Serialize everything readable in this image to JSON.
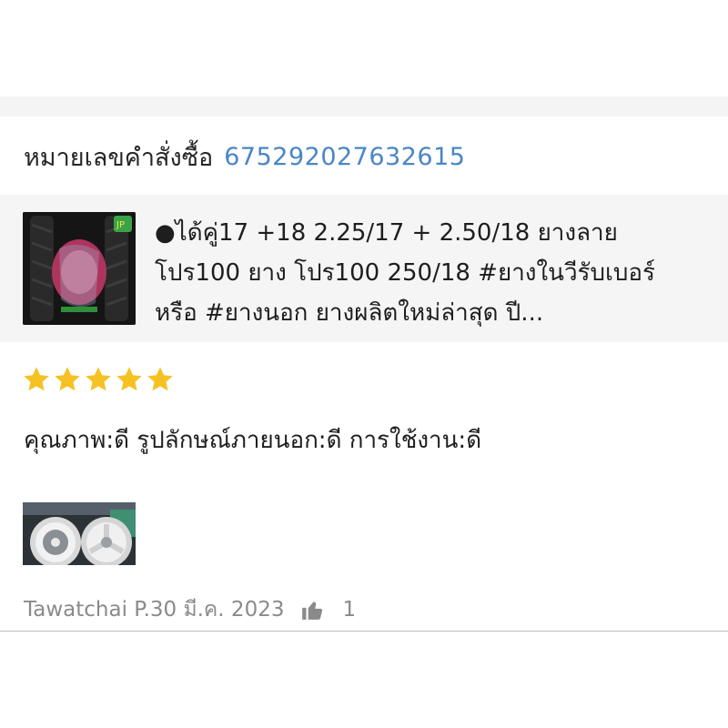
{
  "order": {
    "label": "หมายเลขคำสั่งซื้อ",
    "number": "675292027632615"
  },
  "product": {
    "title": "●ได้คู่17 +18  2.25/17 + 2.50/18   ยางลาย โปร100   ยาง โปร100   250/18 #ยางในวีรับเบอร์ หรือ #ยางนอก ยางผลิตใหม่ล่าสุด ปี...",
    "thumbnail_icon": "tire-product-image"
  },
  "review": {
    "rating": 5,
    "rating_max": 5,
    "star_color": "#f6c223",
    "text": "คุณภาพ:ดี รูปลักษณ์ภายนอก:ดี การใช้งาน:ดี",
    "photo_icon": "motorcycle-wheels-photo"
  },
  "footer": {
    "meta": "Tawatchai P.30 มี.ค. 2023",
    "like_icon": "thumbs-up-icon",
    "like_count": "1"
  },
  "colors": {
    "link": "#4a86c5",
    "muted": "#8a8a8a",
    "card_bg": "#f5f5f5"
  }
}
